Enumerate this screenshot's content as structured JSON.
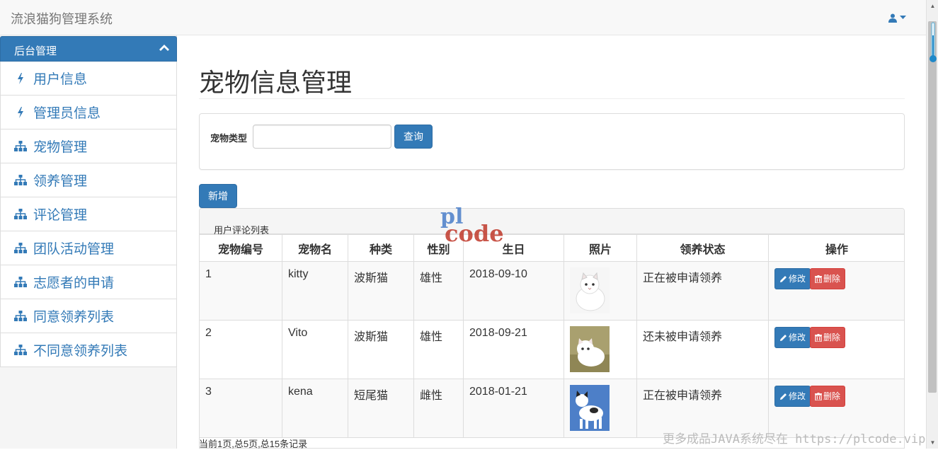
{
  "navbar": {
    "brand": "流浪猫狗管理系统",
    "user_icon": "user-icon"
  },
  "sidebar": {
    "panel_title": "后台管理",
    "items": [
      {
        "label": "用户信息",
        "icon": "bolt-icon"
      },
      {
        "label": "管理员信息",
        "icon": "bolt-icon"
      },
      {
        "label": "宠物管理",
        "icon": "sitemap-icon"
      },
      {
        "label": "领养管理",
        "icon": "sitemap-icon"
      },
      {
        "label": "评论管理",
        "icon": "sitemap-icon"
      },
      {
        "label": "团队活动管理",
        "icon": "sitemap-icon"
      },
      {
        "label": "志愿者的申请",
        "icon": "sitemap-icon"
      },
      {
        "label": "同意领养列表",
        "icon": "sitemap-icon"
      },
      {
        "label": "不同意领养列表",
        "icon": "sitemap-icon"
      }
    ]
  },
  "main": {
    "title": "宠物信息管理",
    "search": {
      "label": "宠物类型",
      "value": "",
      "button": "查询"
    },
    "add_button": "新增",
    "list_title": "用户评论列表",
    "columns": [
      "宠物编号",
      "宠物名",
      "种类",
      "性别",
      "生日",
      "照片",
      "领养状态",
      "操作"
    ],
    "rows": [
      {
        "id": "1",
        "name": "kitty",
        "type": "波斯猫",
        "sex": "雄性",
        "birthday": "2018-09-10",
        "photo": "white-persian-cat",
        "status": "正在被申请领养"
      },
      {
        "id": "2",
        "name": "Vito",
        "type": "波斯猫",
        "sex": "雄性",
        "birthday": "2018-09-21",
        "photo": "white-persian-kitten",
        "status": "还未被申请领养"
      },
      {
        "id": "3",
        "name": "kena",
        "type": "短尾猫",
        "sex": "雌性",
        "birthday": "2018-01-21",
        "photo": "calico-bobtail-cat",
        "status": "正在被申请领养"
      }
    ],
    "edit_label": "修改",
    "delete_label": "删除",
    "pager": "当前1页,总5页,总15条记录"
  },
  "watermark": {
    "logo_top": "pl",
    "logo_bottom": "code",
    "text": "更多成品JAVA系统尽在 https://plcode.vip"
  },
  "colors": {
    "primary": "#337ab7",
    "danger": "#d9534f",
    "navbar_bg": "#f8f8f8"
  }
}
